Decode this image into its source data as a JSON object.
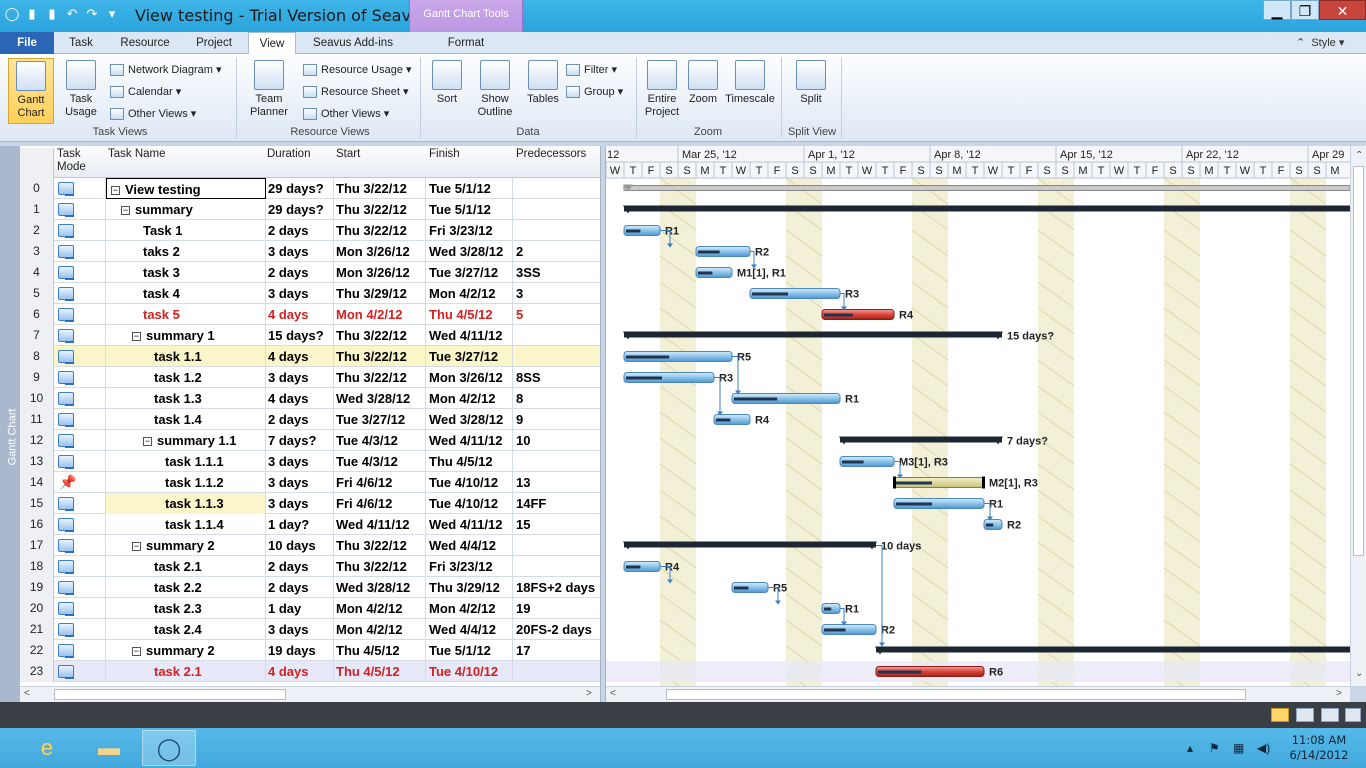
{
  "window": {
    "title": "View testing - Trial Version of Seavus Pr...",
    "contextual_tab_group": "Gantt Chart Tools",
    "minimize": "▁",
    "maximize": "❐",
    "close": "✕"
  },
  "ribbon_tabs": [
    "File",
    "Task",
    "Resource",
    "Project",
    "View",
    "Seavus Add-ins",
    "Format"
  ],
  "active_tab": "View",
  "style_menu": "Style",
  "ribbon": {
    "task_views": {
      "label": "Task Views",
      "gantt_chart": "Gantt Chart",
      "task_usage": "Task Usage",
      "network_diagram": "Network Diagram",
      "calendar": "Calendar",
      "other_views": "Other Views"
    },
    "resource_views": {
      "label": "Resource Views",
      "team_planner": "Team Planner",
      "resource_usage": "Resource Usage",
      "resource_sheet": "Resource Sheet",
      "other_views": "Other Views"
    },
    "data": {
      "label": "Data",
      "sort": "Sort",
      "show_outline": "Show Outline",
      "tables": "Tables",
      "filter": "Filter",
      "group": "Group"
    },
    "zoom": {
      "label": "Zoom",
      "entire_project": "Entire Project",
      "zoom": "Zoom",
      "timescale": "Timescale"
    },
    "split_view": {
      "label": "Split View",
      "split": "Split"
    }
  },
  "side_label": "Gantt Chart",
  "table": {
    "headers": {
      "task_mode": "Task Mode",
      "task_name": "Task Name",
      "duration": "Duration",
      "start": "Start",
      "finish": "Finish",
      "predecessors": "Predecessors"
    },
    "rows": [
      {
        "id": "0",
        "mode": "auto",
        "name": "View testing",
        "indent": 0,
        "summary": true,
        "duration": "29 days?",
        "start": "Thu 3/22/12",
        "finish": "Tue 5/1/12",
        "pred": "",
        "critical": false,
        "highlight": ""
      },
      {
        "id": "1",
        "mode": "auto",
        "name": "summary",
        "indent": 1,
        "summary": true,
        "duration": "29 days?",
        "start": "Thu 3/22/12",
        "finish": "Tue 5/1/12",
        "pred": "",
        "critical": false,
        "highlight": ""
      },
      {
        "id": "2",
        "mode": "auto",
        "name": "Task 1",
        "indent": 3,
        "summary": false,
        "duration": "2 days",
        "start": "Thu 3/22/12",
        "finish": "Fri 3/23/12",
        "pred": "",
        "critical": false,
        "highlight": ""
      },
      {
        "id": "3",
        "mode": "auto",
        "name": "taks 2",
        "indent": 3,
        "summary": false,
        "duration": "3 days",
        "start": "Mon 3/26/12",
        "finish": "Wed 3/28/12",
        "pred": "2",
        "critical": false,
        "highlight": ""
      },
      {
        "id": "4",
        "mode": "auto",
        "name": "task 3",
        "indent": 3,
        "summary": false,
        "duration": "2 days",
        "start": "Mon 3/26/12",
        "finish": "Tue 3/27/12",
        "pred": "3SS",
        "critical": false,
        "highlight": ""
      },
      {
        "id": "5",
        "mode": "auto",
        "name": "task 4",
        "indent": 3,
        "summary": false,
        "duration": "3 days",
        "start": "Thu 3/29/12",
        "finish": "Mon 4/2/12",
        "pred": "3",
        "critical": false,
        "highlight": ""
      },
      {
        "id": "6",
        "mode": "auto",
        "name": "task 5",
        "indent": 3,
        "summary": false,
        "duration": "4 days",
        "start": "Mon 4/2/12",
        "finish": "Thu 4/5/12",
        "pred": "5",
        "critical": true,
        "highlight": ""
      },
      {
        "id": "7",
        "mode": "auto",
        "name": "summary 1",
        "indent": 2,
        "summary": true,
        "duration": "15 days?",
        "start": "Thu 3/22/12",
        "finish": "Wed 4/11/12",
        "pred": "",
        "critical": false,
        "highlight": ""
      },
      {
        "id": "8",
        "mode": "auto",
        "name": "task 1.1",
        "indent": 4,
        "summary": false,
        "duration": "4 days",
        "start": "Thu 3/22/12",
        "finish": "Tue 3/27/12",
        "pred": "",
        "critical": false,
        "highlight": "yellow"
      },
      {
        "id": "9",
        "mode": "auto",
        "name": "task 1.2",
        "indent": 4,
        "summary": false,
        "duration": "3 days",
        "start": "Thu 3/22/12",
        "finish": "Mon 3/26/12",
        "pred": "8SS",
        "critical": false,
        "highlight": ""
      },
      {
        "id": "10",
        "mode": "auto",
        "name": "task 1.3",
        "indent": 4,
        "summary": false,
        "duration": "4 days",
        "start": "Wed 3/28/12",
        "finish": "Mon 4/2/12",
        "pred": "8",
        "critical": false,
        "highlight": ""
      },
      {
        "id": "11",
        "mode": "auto",
        "name": "task 1.4",
        "indent": 4,
        "summary": false,
        "duration": "2 days",
        "start": "Tue 3/27/12",
        "finish": "Wed 3/28/12",
        "pred": "9",
        "critical": false,
        "highlight": ""
      },
      {
        "id": "12",
        "mode": "auto",
        "name": "summary 1.1",
        "indent": 3,
        "summary": true,
        "duration": "7 days?",
        "start": "Tue 4/3/12",
        "finish": "Wed 4/11/12",
        "pred": "10",
        "critical": false,
        "highlight": ""
      },
      {
        "id": "13",
        "mode": "auto",
        "name": "task 1.1.1",
        "indent": 5,
        "summary": false,
        "duration": "3 days",
        "start": "Tue 4/3/12",
        "finish": "Thu 4/5/12",
        "pred": "",
        "critical": false,
        "highlight": ""
      },
      {
        "id": "14",
        "mode": "manual",
        "name": "task 1.1.2",
        "indent": 5,
        "summary": false,
        "duration": "3 days",
        "start": "Fri 4/6/12",
        "finish": "Tue 4/10/12",
        "pred": "13",
        "critical": false,
        "highlight": ""
      },
      {
        "id": "15",
        "mode": "auto",
        "name": "task 1.1.3",
        "indent": 5,
        "summary": false,
        "duration": "3 days",
        "start": "Fri 4/6/12",
        "finish": "Tue 4/10/12",
        "pred": "14FF",
        "critical": false,
        "highlight": "yellow-name"
      },
      {
        "id": "16",
        "mode": "auto",
        "name": "task 1.1.4",
        "indent": 5,
        "summary": false,
        "duration": "1 day?",
        "start": "Wed 4/11/12",
        "finish": "Wed 4/11/12",
        "pred": "15",
        "critical": false,
        "highlight": ""
      },
      {
        "id": "17",
        "mode": "auto",
        "name": "summary 2",
        "indent": 2,
        "summary": true,
        "duration": "10 days",
        "start": "Thu 3/22/12",
        "finish": "Wed 4/4/12",
        "pred": "",
        "critical": false,
        "highlight": ""
      },
      {
        "id": "18",
        "mode": "auto",
        "name": "task 2.1",
        "indent": 4,
        "summary": false,
        "duration": "2 days",
        "start": "Thu 3/22/12",
        "finish": "Fri 3/23/12",
        "pred": "",
        "critical": false,
        "highlight": ""
      },
      {
        "id": "19",
        "mode": "auto",
        "name": "task 2.2",
        "indent": 4,
        "summary": false,
        "duration": "2 days",
        "start": "Wed 3/28/12",
        "finish": "Thu 3/29/12",
        "pred": "18FS+2 days",
        "critical": false,
        "highlight": ""
      },
      {
        "id": "20",
        "mode": "auto",
        "name": "task 2.3",
        "indent": 4,
        "summary": false,
        "duration": "1 day",
        "start": "Mon 4/2/12",
        "finish": "Mon 4/2/12",
        "pred": "19",
        "critical": false,
        "highlight": ""
      },
      {
        "id": "21",
        "mode": "auto",
        "name": "task 2.4",
        "indent": 4,
        "summary": false,
        "duration": "3 days",
        "start": "Mon 4/2/12",
        "finish": "Wed 4/4/12",
        "pred": "20FS-2 days",
        "critical": false,
        "highlight": ""
      },
      {
        "id": "22",
        "mode": "auto",
        "name": "summary 2",
        "indent": 2,
        "summary": true,
        "duration": "19 days",
        "start": "Thu 4/5/12",
        "finish": "Tue 5/1/12",
        "pred": "17",
        "critical": false,
        "highlight": ""
      },
      {
        "id": "23",
        "mode": "auto",
        "name": "task 2.1",
        "indent": 4,
        "summary": false,
        "duration": "4 days",
        "start": "Thu 4/5/12",
        "finish": "Tue 4/10/12",
        "pred": "",
        "critical": true,
        "highlight": "blue"
      }
    ]
  },
  "timescale": {
    "weeks": [
      "12",
      "Mar 25, '12",
      "Apr 1, '12",
      "Apr 8, '12",
      "Apr 15, '12",
      "Apr 22, '12",
      "Apr 29"
    ],
    "day_letters": [
      "W",
      "T",
      "F",
      "S",
      "S",
      "M",
      "T",
      "W",
      "T",
      "F",
      "S",
      "S",
      "M",
      "T",
      "W",
      "T",
      "F",
      "S",
      "S",
      "M",
      "T",
      "W",
      "T",
      "F",
      "S",
      "S",
      "M",
      "T",
      "W",
      "T",
      "F",
      "S",
      "S",
      "M",
      "T",
      "W",
      "T",
      "F",
      "S",
      "S",
      "M"
    ]
  },
  "gantt_labels": {
    "2": "R1",
    "3": "R2",
    "4": "M1[1], R1",
    "5": "R3",
    "6": "R4",
    "7": "15 days?",
    "8": "R5",
    "9": "R3",
    "10": "R1",
    "11": "R4",
    "12": "7 days?",
    "13": "M3[1], R3",
    "14": "M2[1], R3",
    "15": "R1",
    "16": "R2",
    "17": "10 days",
    "18": "R4",
    "19": "R5",
    "20": "R1",
    "21": "R2",
    "23": "R6"
  },
  "taskbar": {
    "time": "11:08 AM",
    "date": "6/14/2012"
  }
}
